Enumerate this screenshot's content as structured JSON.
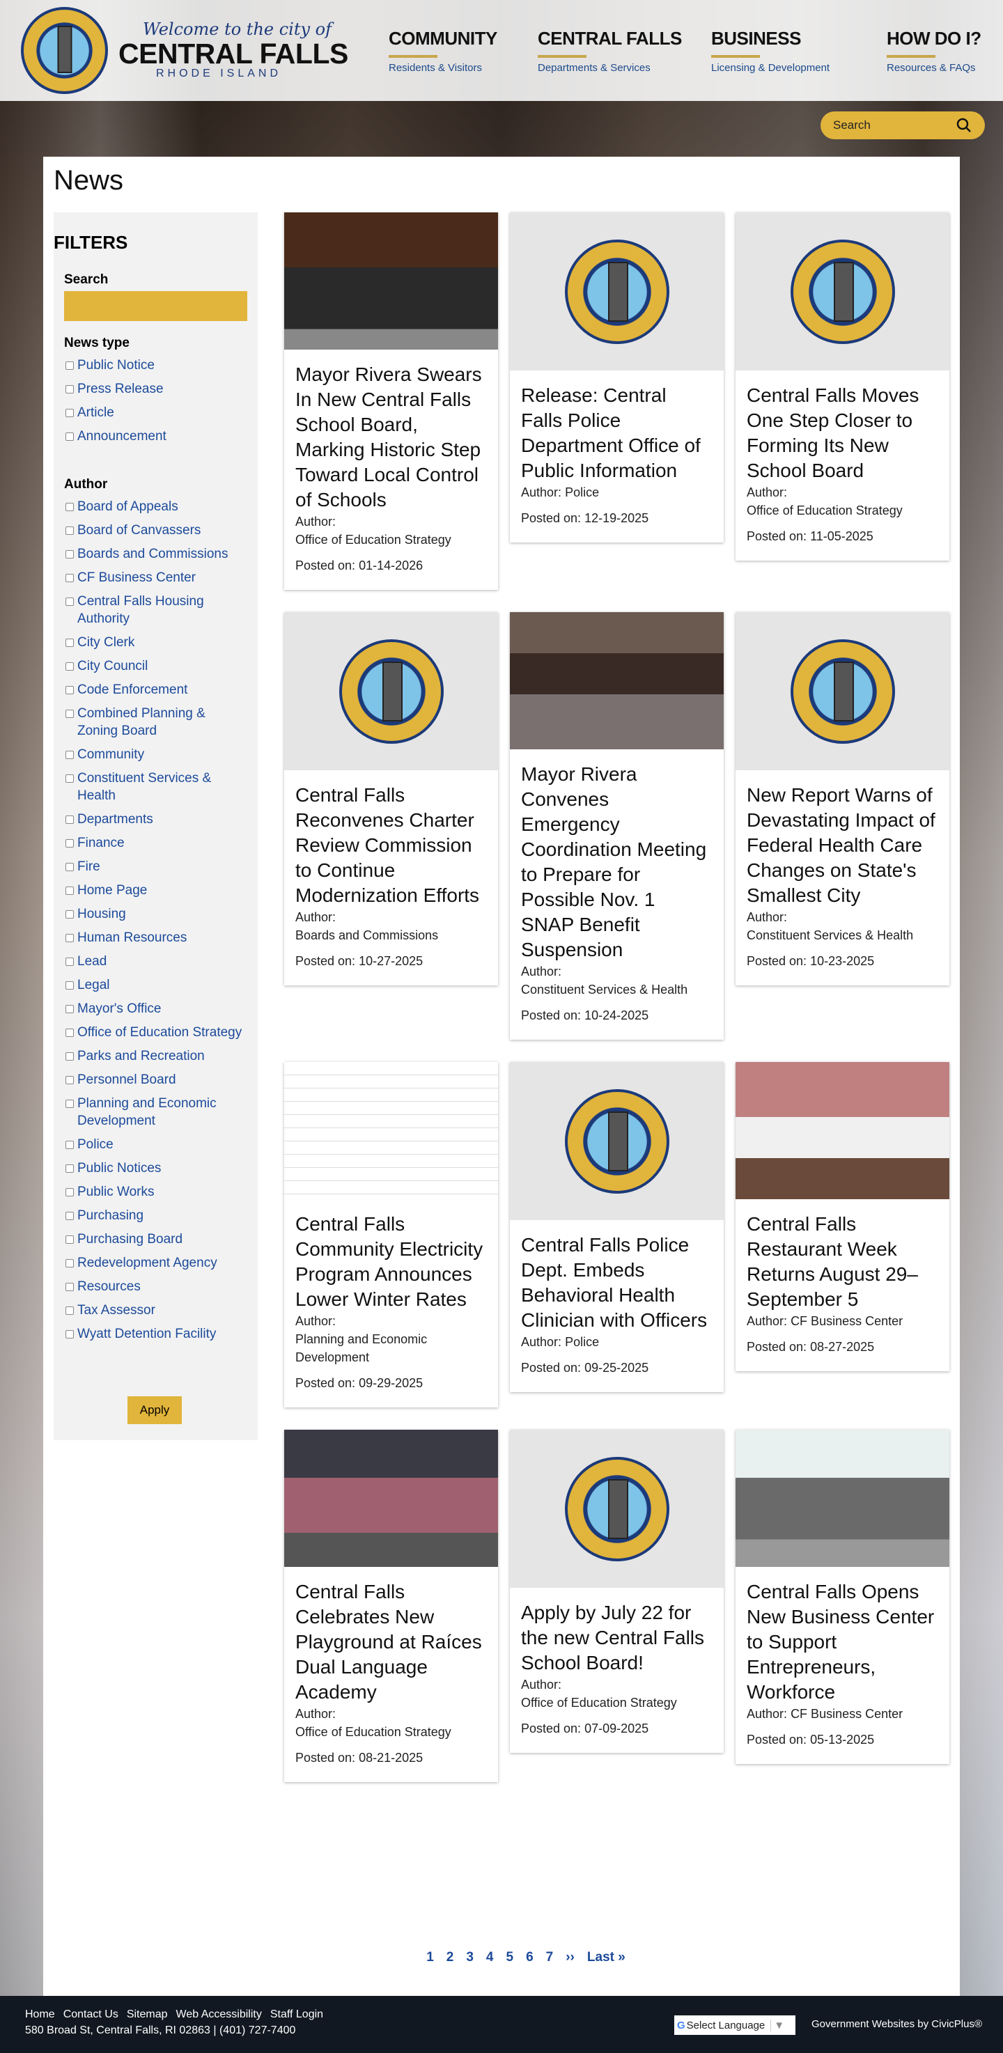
{
  "header": {
    "welcome": "Welcome to the city of",
    "city": "CENTRAL FALLS",
    "state": "RHODE ISLAND",
    "nav": [
      {
        "title": "COMMUNITY",
        "sub": "Residents & Visitors"
      },
      {
        "title": "CENTRAL FALLS",
        "sub": "Departments & Services"
      },
      {
        "title": "BUSINESS",
        "sub": "Licensing & Development"
      },
      {
        "title": "HOW DO I?",
        "sub": "Resources & FAQs"
      }
    ],
    "search_placeholder": "Search"
  },
  "page_title": "News",
  "filters": {
    "title": "FILTERS",
    "search_label": "Search",
    "news_type_label": "News type",
    "news_types": [
      "Public Notice",
      "Press Release",
      "Article",
      "Announcement"
    ],
    "author_label": "Author",
    "authors": [
      "Board of Appeals",
      "Board of Canvassers",
      "Boards and Commissions",
      "CF Business Center",
      "Central Falls Housing Authority",
      "City Clerk",
      "City Council",
      "Code Enforcement",
      "Combined Planning & Zoning Board",
      "Community",
      "Constituent Services & Health",
      "Departments",
      "Finance",
      "Fire",
      "Home Page",
      "Housing",
      "Human Resources",
      "Lead",
      "Legal",
      "Mayor's Office",
      "Office of Education Strategy",
      "Parks and Recreation",
      "Personnel Board",
      "Planning and Economic Development",
      "Police",
      "Public Notices",
      "Public Works",
      "Purchasing",
      "Purchasing Board",
      "Redevelopment Agency",
      "Resources",
      "Tax Assessor",
      "Wyatt Detention Facility"
    ],
    "apply_label": "Apply"
  },
  "author_prefix": "Author:",
  "posted_prefix": "Posted on:",
  "cards": [
    {
      "title": "Mayor Rivera Swears In New Central Falls School Board, Marking Historic Step Toward Local Control of Schools",
      "author": "Office of Education Strategy",
      "date": "01-14-2026",
      "image": "p1",
      "break": true
    },
    {
      "title": "Release: Central Falls Police Department Office of Public Information",
      "author": "Police",
      "date": "12-19-2025",
      "image": "seal"
    },
    {
      "title": "Central Falls Moves One Step Closer to Forming Its New School Board",
      "author": "Office of Education Strategy",
      "date": "11-05-2025",
      "image": "seal",
      "break": true
    },
    {
      "title": "Central Falls Reconvenes Charter Review Commission to Continue Modernization Efforts",
      "author": "Boards and Commissions",
      "date": "10-27-2025",
      "image": "seal",
      "break": true
    },
    {
      "title": "Mayor Rivera Convenes Emergency Coordination Meeting to Prepare for Possible Nov. 1 SNAP Benefit Suspension",
      "author": "Constituent Services & Health",
      "date": "10-24-2025",
      "image": "p2",
      "break": true
    },
    {
      "title": "New Report Warns of Devastating Impact of Federal Health Care Changes on State's Smallest City",
      "author": "Constituent Services & Health",
      "date": "10-23-2025",
      "image": "seal",
      "break": true
    },
    {
      "title": "Central Falls Community Electricity Program Announces Lower Winter Rates",
      "author": "Planning and Economic Development",
      "date": "09-29-2025",
      "image": "p3",
      "break": true
    },
    {
      "title": "Central Falls Police Dept. Embeds Behavioral Health Clinician with Officers",
      "author": "Police",
      "date": "09-25-2025",
      "image": "seal"
    },
    {
      "title": "Central Falls Restaurant Week Returns August 29–September 5",
      "author": "CF Business Center",
      "date": "08-27-2025",
      "image": "p4"
    },
    {
      "title": "Central Falls Celebrates New Playground at Raíces Dual Language Academy",
      "author": "Office of Education Strategy",
      "date": "08-21-2025",
      "image": "p5",
      "break": true
    },
    {
      "title": "Apply by July 22 for the new Central Falls School Board!",
      "author": "Office of Education Strategy",
      "date": "07-09-2025",
      "image": "seal",
      "break": true
    },
    {
      "title": "Central Falls Opens New Business Center to Support Entrepreneurs, Workforce",
      "author": "CF Business Center",
      "date": "05-13-2025",
      "image": "p6"
    }
  ],
  "pagination": [
    "1",
    "2",
    "3",
    "4",
    "5",
    "6",
    "7",
    "››",
    "Last »"
  ],
  "footer": {
    "links": [
      "Home",
      "Contact Us",
      "Sitemap",
      "Web Accessibility",
      "Staff Login"
    ],
    "address": "580 Broad St, Central Falls, RI 02863 | (401) 727-7400",
    "language": "Select Language",
    "credit": "Government Websites by CivicPlus®"
  }
}
